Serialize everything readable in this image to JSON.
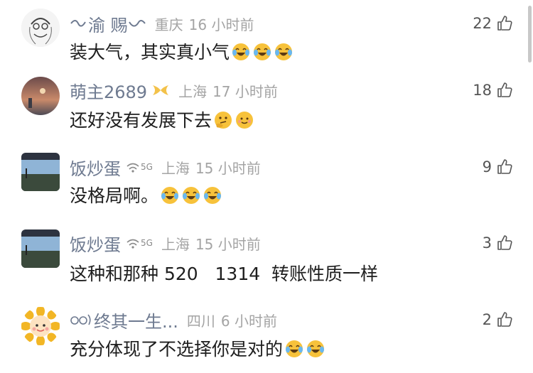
{
  "comments": [
    {
      "username": "渝 赐",
      "location": "重庆",
      "time": "16 小时前",
      "text": "装大气，其实真小气",
      "emoji": [
        "laugh-cry-emoji",
        "laugh-cry-emoji",
        "laugh-cry-emoji"
      ],
      "likes": "22"
    },
    {
      "username": "萌主2689",
      "location": "上海",
      "time": "17 小时前",
      "text": "还好没有发展下去",
      "emoji": [
        "thinking-emoji",
        "smile-emoji"
      ],
      "likes": "18"
    },
    {
      "username": "饭炒蛋",
      "signal": "5G",
      "location": "上海",
      "time": "15 小时前",
      "text": "没格局啊。",
      "emoji": [
        "laugh-cry-emoji",
        "laugh-cry-emoji",
        "laugh-cry-emoji"
      ],
      "likes": "9"
    },
    {
      "username": "饭炒蛋",
      "signal": "5G",
      "location": "上海",
      "time": "15 小时前",
      "text": "这种和那种 520   1314  转账性质一样",
      "emoji": [],
      "likes": "3"
    },
    {
      "username": "终其一生...",
      "location": "四川",
      "time": "6 小时前",
      "text": "充分体现了不选择你是对的",
      "emoji": [
        "laugh-cry-emoji",
        "laugh-cry-emoji"
      ],
      "likes": "2"
    }
  ],
  "colors": {
    "username": "#6e7a90",
    "meta": "#a4a4a4",
    "text": "#1e1e1e",
    "emoji_face": "#f7c23b"
  }
}
